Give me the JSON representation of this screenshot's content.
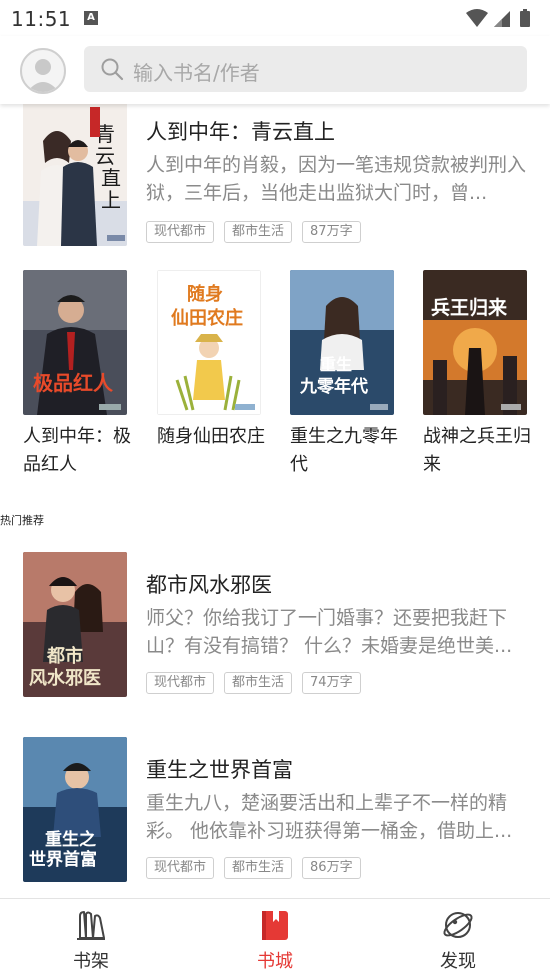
{
  "status_bar": {
    "time": "11:51",
    "notification_icon": "A"
  },
  "search": {
    "placeholder": "输入书名/作者"
  },
  "featured": {
    "title": "人到中年：青云直上",
    "description": "人到中年的肖毅，因为一笔违规贷款被判刑入狱，三年后，当他走出监狱大门时，曾...",
    "tags": [
      "现代都市",
      "都市生活",
      "87万字"
    ]
  },
  "grid": [
    {
      "title": "人到中年：极品红人"
    },
    {
      "title": "随身仙田农庄"
    },
    {
      "title": "重生之九零年代"
    },
    {
      "title": "战神之兵王归来"
    }
  ],
  "section_label": "热门推荐",
  "hot": [
    {
      "title": "都市风水邪医",
      "description": "师父？你给我订了一门婚事？还要把我赶下山？有没有搞错？ 什么？未婚妻是绝世美...",
      "tags": [
        "现代都市",
        "都市生活",
        "74万字"
      ]
    },
    {
      "title": "重生之世界首富",
      "description": "重生九八，楚涵要活出和上辈子不一样的精彩。 他依靠补习班获得第一桶金，借助上...",
      "tags": [
        "现代都市",
        "都市生活",
        "86万字"
      ]
    }
  ],
  "bottom_nav": [
    {
      "label": "书架",
      "icon": "bookshelf-icon",
      "active": false
    },
    {
      "label": "书城",
      "icon": "book-icon",
      "active": true
    },
    {
      "label": "发现",
      "icon": "planet-icon",
      "active": false
    }
  ],
  "colors": {
    "accent": "#e53935",
    "search_bg": "#ebebeb",
    "tag_border": "#cfcfcf",
    "muted_text": "#8a8a8a"
  }
}
